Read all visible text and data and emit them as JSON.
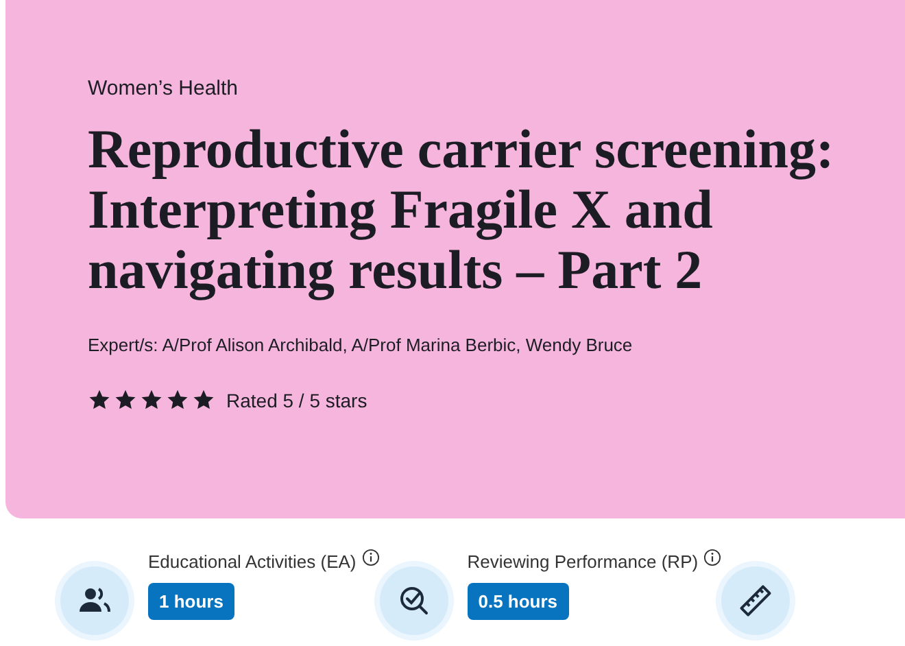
{
  "category": "Women’s Health",
  "title": "Reproductive carrier screening: Interpreting Fragile X and navigating results – Part 2",
  "experts": "Expert/s: A/Prof Alison Archibald, A/Prof Marina Berbic, Wendy Bruce",
  "rating": {
    "stars": 5,
    "label": "Rated 5 / 5 stars"
  },
  "activities": [
    {
      "kind": "people",
      "label": "Educational Activities (EA)",
      "hours": "1 hours"
    },
    {
      "kind": "check-search",
      "label": "Reviewing Performance (RP)",
      "hours": "0.5 hours"
    },
    {
      "kind": "ruler"
    }
  ]
}
